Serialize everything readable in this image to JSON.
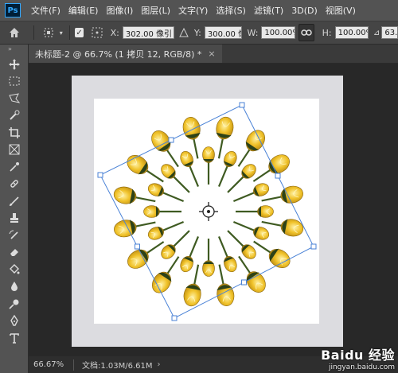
{
  "app": {
    "logo": "Ps",
    "menu": [
      "文件(F)",
      "编辑(E)",
      "图像(I)",
      "图层(L)",
      "文字(Y)",
      "选择(S)",
      "滤镜(T)",
      "3D(D)",
      "视图(V)"
    ]
  },
  "options_bar": {
    "x_label": "X:",
    "x_value": "302.00 像引",
    "y_label": "Y:",
    "y_value": "300.00 像引",
    "w_label": "W:",
    "w_value": "100.00%",
    "h_label": "H:",
    "h_value": "100.00%",
    "angle_value": "63."
  },
  "document": {
    "tab_title": "未标题-2 @ 66.7% (1 拷贝 12, RGB/8) *",
    "close": "×"
  },
  "status": {
    "zoom": "66.67%",
    "doc_size": "文档:1.03M/6.61M",
    "arrow": "›"
  },
  "watermark": {
    "main": "Baidu 经验",
    "sub": "jingyan.baidu.com"
  },
  "colors": {
    "ui_bg": "#535353",
    "canvas_bg": "#282828",
    "flower_yellow": "#e8b21c",
    "stem_green": "#3f5b22",
    "transform_box": "#4a82d6"
  },
  "tools": [
    "move-icon",
    "marquee-icon",
    "lasso-icon",
    "quick-select-icon",
    "crop-icon",
    "frame-icon",
    "eyedropper-icon",
    "healing-icon",
    "brush-icon",
    "stamp-icon",
    "history-brush-icon",
    "eraser-icon",
    "paint-bucket-icon",
    "blur-icon",
    "dodge-icon",
    "pen-icon",
    "type-icon"
  ]
}
